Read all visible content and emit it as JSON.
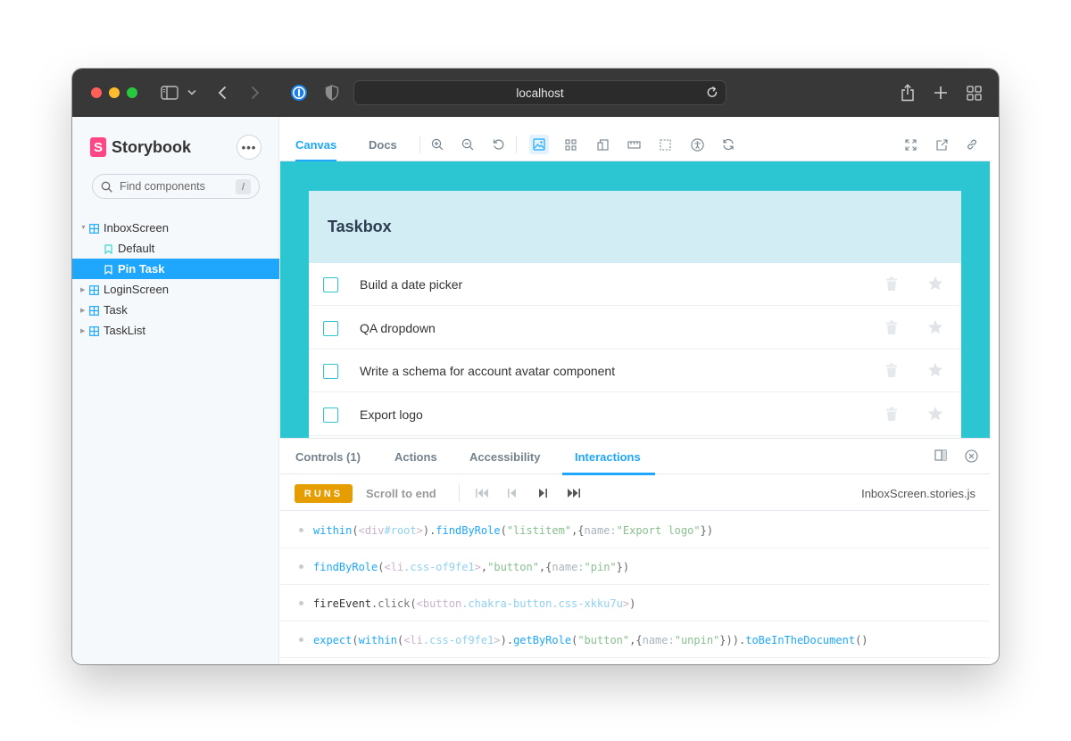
{
  "browser": {
    "url": "localhost"
  },
  "sidebar": {
    "brand": "Storybook",
    "search_placeholder": "Find components",
    "search_shortcut": "/",
    "tree": [
      {
        "label": "InboxScreen",
        "kind": "component",
        "expanded": true
      },
      {
        "label": "Default",
        "kind": "story"
      },
      {
        "label": "Pin Task",
        "kind": "story",
        "selected": true
      },
      {
        "label": "LoginScreen",
        "kind": "component"
      },
      {
        "label": "Task",
        "kind": "component"
      },
      {
        "label": "TaskList",
        "kind": "component"
      }
    ]
  },
  "toolbar": {
    "tabs": [
      "Canvas",
      "Docs"
    ],
    "active_tab": "Canvas"
  },
  "canvas": {
    "title": "Taskbox",
    "tasks": [
      "Build a date picker",
      "QA dropdown",
      "Write a schema for account avatar component",
      "Export logo"
    ]
  },
  "panel": {
    "tabs": [
      "Controls (1)",
      "Actions",
      "Accessibility",
      "Interactions"
    ],
    "active_tab": "Interactions",
    "status": "RUNS",
    "scroll_to_end": "Scroll to end",
    "file": "InboxScreen.stories.js",
    "logs": [
      "within(<div#root>).findByRole(\"listitem\", { name: \"Export logo\" })",
      "findByRole(<li.css-of9fe1>, \"button\", { name: \"pin\" })",
      "fireEvent.click(<button.chakra-button.css-xkku7u>)",
      "expect(within(<li.css-of9fe1>).getByRole(\"button\", { name: \"unpin\" })).toBeInTheDocument()"
    ]
  },
  "colors": {
    "accent": "#1ea7fd",
    "brand": "#ff4785",
    "canvas_bg": "#2cc5d2",
    "runs_badge": "#e69d00"
  }
}
